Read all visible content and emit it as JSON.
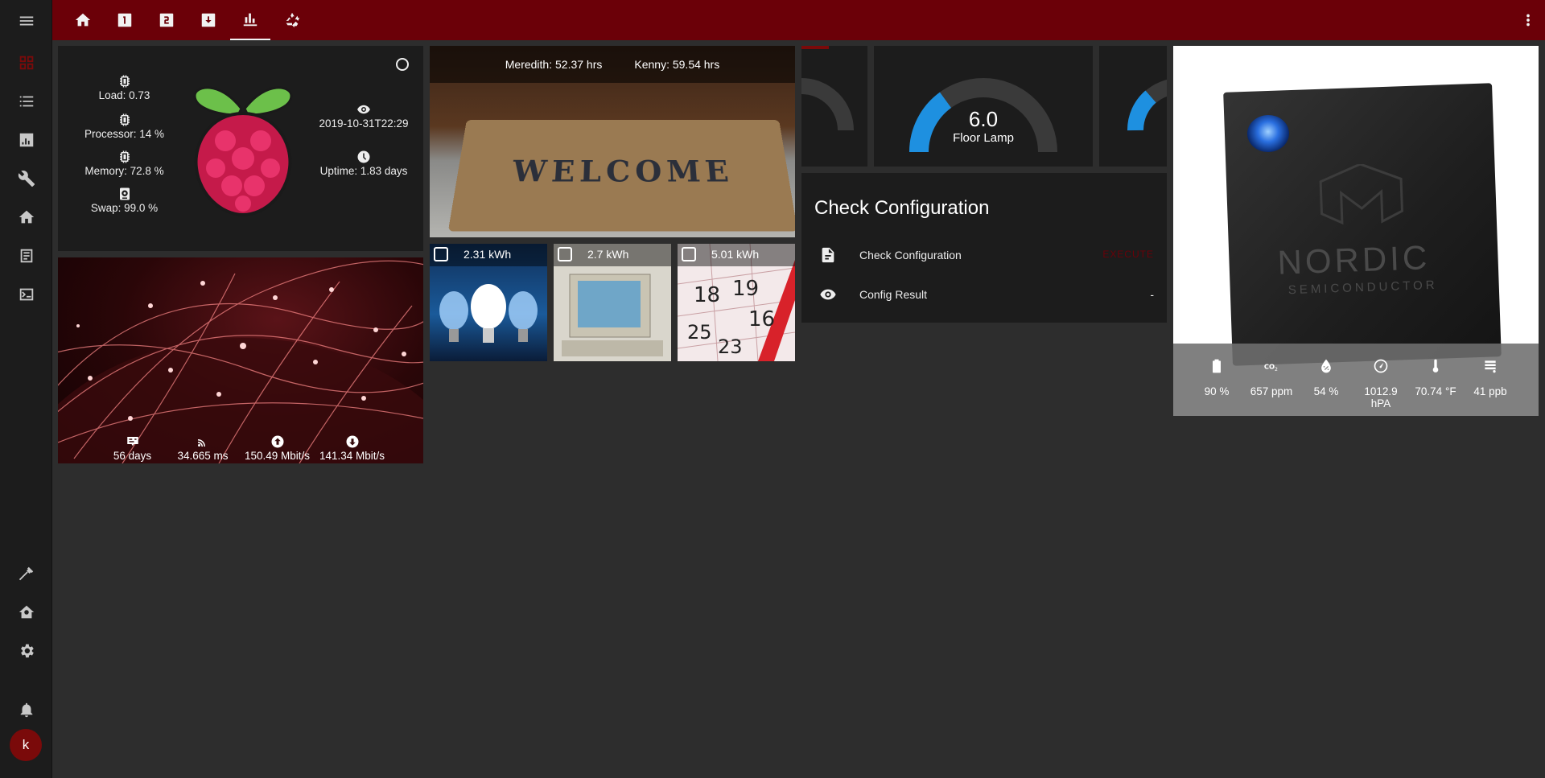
{
  "colors": {
    "topbar": "#6b0008",
    "sidebar": "#1c1c1c",
    "background": "#2d2d2d",
    "card": "#1c1c1c",
    "gauge_arc": "#1e90e0",
    "gauge_track": "#3a3a3a",
    "accent": "#7a0a0a"
  },
  "sidebar": {
    "items": [
      {
        "icon": "grid-icon",
        "active": true
      },
      {
        "icon": "list-icon"
      },
      {
        "icon": "chart-icon"
      },
      {
        "icon": "wrench-icon"
      },
      {
        "icon": "home-icon"
      },
      {
        "icon": "logbook-icon"
      },
      {
        "icon": "terminal-icon"
      },
      {
        "icon": "hammer-icon"
      },
      {
        "icon": "house-config-icon"
      },
      {
        "icon": "gear-icon"
      },
      {
        "icon": "bell-icon"
      }
    ],
    "avatar_initial": "k"
  },
  "topbar": {
    "tabs": [
      {
        "icon": "home-icon"
      },
      {
        "icon": "numeric-1-box-icon"
      },
      {
        "icon": "numeric-2-box-icon"
      },
      {
        "icon": "download-box-icon"
      },
      {
        "icon": "bar-chart-icon",
        "active": true
      },
      {
        "icon": "recycle-icon"
      }
    ],
    "menu_icon": "menu-icon",
    "more_icon": "dots-vertical-icon"
  },
  "rpi": {
    "load": "Load: 0.73",
    "processor": "Processor: 14 %",
    "memory": "Memory: 72.8 %",
    "swap": "Swap: 99.0 %",
    "last_boot": "2019-10-31T22:29",
    "uptime": "Uptime: 1.83 days"
  },
  "network": {
    "uptime": "56 days",
    "ping": "34.665 ms",
    "upload": "150.49 Mbit/s",
    "download": "141.34 Mbit/s"
  },
  "welcome": {
    "mat_text": "WELCOME",
    "meredith": "Meredith: 52.37 hrs",
    "kenny": "Kenny: 59.54 hrs"
  },
  "energy": [
    {
      "value": "2.31 kWh"
    },
    {
      "value": "2.7 kWh"
    },
    {
      "value": "5.01 kWh"
    }
  ],
  "gauges": {
    "main": {
      "value": "6.0",
      "name": "Floor Lamp",
      "fraction": 0.3
    }
  },
  "check_config": {
    "title": "Check Configuration",
    "row1_label": "Check Configuration",
    "row1_action": "EXECUTE",
    "row2_label": "Config Result",
    "row2_value": "-"
  },
  "nordic": {
    "brand": "NORDIC",
    "sub": "SEMICONDUCTOR",
    "battery": "90 %",
    "co2": "657 ppm",
    "humidity": "54 %",
    "pressure": "1012.9 hPA",
    "temperature": "70.74 °F",
    "tvoc": "41 ppb"
  }
}
